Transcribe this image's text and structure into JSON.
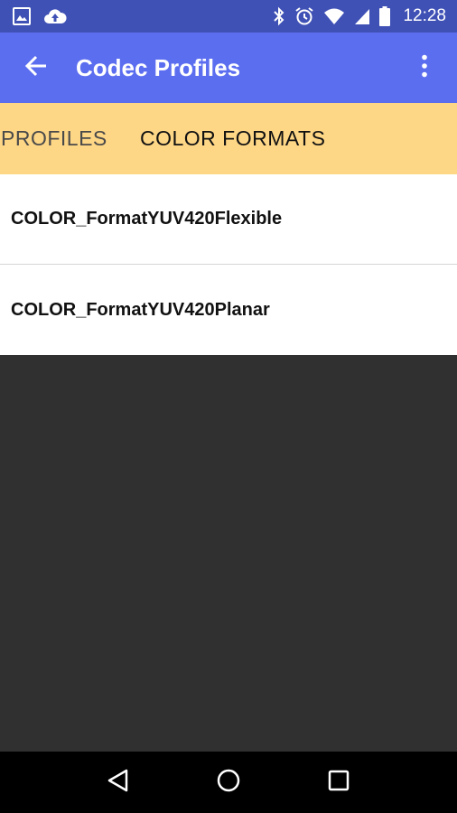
{
  "status_bar": {
    "time": "12:28",
    "left_icons": [
      "image-icon",
      "cloud-upload-icon"
    ],
    "right_icons": [
      "bluetooth-icon",
      "alarm-icon",
      "wifi-icon",
      "signal-icon",
      "battery-icon"
    ]
  },
  "app_bar": {
    "title": "Codec Profiles",
    "back_icon": "arrow-back-icon",
    "menu_icon": "more-vert-icon"
  },
  "tabs": [
    {
      "label": "PROFILES",
      "selected": false
    },
    {
      "label": "COLOR FORMATS",
      "selected": true
    }
  ],
  "color_formats": [
    {
      "label": "COLOR_FormatYUV420Flexible"
    },
    {
      "label": "COLOR_FormatYUV420Planar"
    }
  ],
  "nav_bar": {
    "buttons": [
      "back-triangle-icon",
      "home-circle-icon",
      "recents-square-icon"
    ]
  },
  "colors": {
    "status_bar": "#3f51b5",
    "app_bar": "#5c6ef0",
    "tab_bar": "#fdd686",
    "content_bg": "#303030",
    "list_bg": "#ffffff",
    "nav_bar": "#000000"
  }
}
